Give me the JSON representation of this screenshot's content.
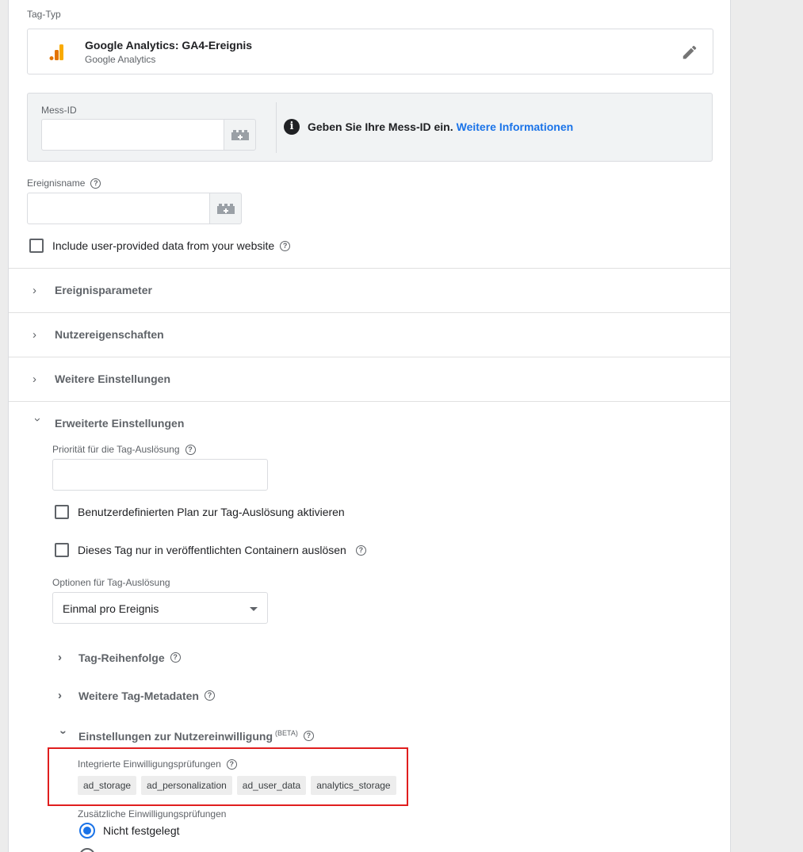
{
  "tag_type": {
    "label": "Tag-Typ",
    "title": "Google Analytics: GA4-Ereignis",
    "subtitle": "Google Analytics",
    "icon": "google-analytics-icon",
    "edit_icon": "pencil-icon"
  },
  "measurement": {
    "label": "Mess-ID",
    "value": "",
    "info_text": "Geben Sie Ihre Mess-ID ein.",
    "info_link": "Weitere Informationen"
  },
  "event_name": {
    "label": "Ereignisname",
    "value": ""
  },
  "user_data_checkbox": {
    "label": "Include user-provided data from your website",
    "checked": false
  },
  "sections": [
    {
      "title": "Ereignisparameter",
      "expanded": false
    },
    {
      "title": "Nutzereigenschaften",
      "expanded": false
    },
    {
      "title": "Weitere Einstellungen",
      "expanded": false
    },
    {
      "title": "Erweiterte Einstellungen",
      "expanded": true
    }
  ],
  "advanced": {
    "priority_label": "Priorität für die Tag-Auslösung",
    "priority_value": "",
    "custom_schedule_label": "Benutzerdefinierten Plan zur Tag-Auslösung aktivieren",
    "published_only_label": "Dieses Tag nur in veröffentlichten Containern auslösen",
    "firing_options_label": "Optionen für Tag-Auslösung",
    "firing_options_value": "Einmal pro Ereignis",
    "tag_sequencing": "Tag-Reihenfolge",
    "tag_metadata": "Weitere Tag-Metadaten",
    "consent_settings": "Einstellungen zur Nutzereinwilligung",
    "consent_beta": "(BETA)",
    "built_in_consent_label": "Integrierte Einwilligungsprüfungen",
    "built_in_consent_chips": [
      "ad_storage",
      "ad_personalization",
      "ad_user_data",
      "analytics_storage"
    ],
    "additional_consent_label": "Zusätzliche Einwilligungsprüfungen",
    "additional_consent_option": "Nicht festgelegt"
  },
  "colors": {
    "accent": "#1a73e8",
    "highlight": "#e01e1e",
    "ga_orange": "#f9ab00",
    "ga_dark_orange": "#e37400"
  }
}
